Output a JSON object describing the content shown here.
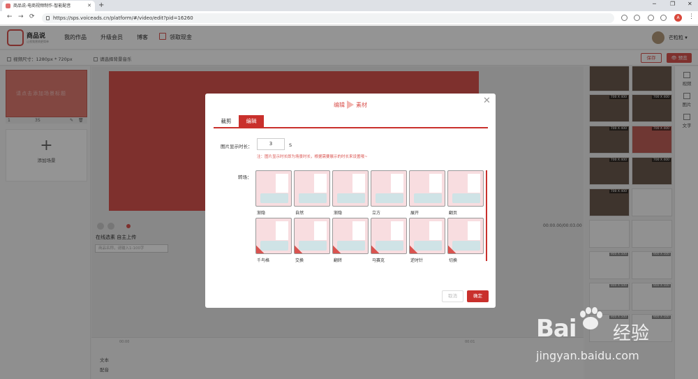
{
  "browser": {
    "tab_title": "商品说-电商视频制作-智能配音",
    "url": "https://sps.voiceads.cn/platform/#/video/edit?pid=16260",
    "profile_initial": "A"
  },
  "app": {
    "logo_text": "商品说",
    "logo_sub": "让视频营销更简单",
    "nav": [
      "我的作品",
      "升级会员",
      "博客",
      "领取现金"
    ],
    "username": "芒粒粒 ▾"
  },
  "toolbar": {
    "video_size": "视频尺寸：1280px * 720px",
    "bg_music": "请选择背景音乐",
    "save": "保存",
    "preview": "👁 预览"
  },
  "scenes": {
    "card_text": "请点击添加场景标题",
    "card_index": "1",
    "card_duration": "3S",
    "add_label": "添加场景"
  },
  "stage": {
    "timecode": "00:00.00/00:03.00",
    "subtabs": "在线选素    自主上传",
    "search_placeholder": "商品名称，请输入1-100字",
    "lower_labels": [
      "文本",
      "配音"
    ],
    "ticks": [
      "00:00",
      "00:01"
    ]
  },
  "media": {
    "badges": [
      "700 X 400",
      "700 X 400",
      "700 X 400",
      "700 X 400",
      "700 X 400",
      "700 X 400",
      "700 X 400",
      "900 X 500",
      "900 X 500",
      "900 X 500",
      "900 X 500",
      "900 X 500",
      "900 X 500"
    ]
  },
  "rail": {
    "items": [
      "视频",
      "图片",
      "文字"
    ]
  },
  "modal": {
    "title_left": "编辑",
    "title_right": "素材",
    "tabs": [
      "裁剪",
      "编辑"
    ],
    "duration_label": "图片显示时长：",
    "duration_value": "3",
    "duration_unit": "S",
    "note": "注：图片显示时长即为场景时长，根据需要展示的时长来设置哦~",
    "transition_label": "转场：",
    "transitions": [
      "渐隐",
      "自然",
      "渐隐",
      "立方",
      "展开",
      "翻页",
      "千鸟格",
      "交换",
      "翻转",
      "马赛克",
      "逆时针",
      "切换"
    ],
    "cancel": "取消",
    "confirm": "确定"
  },
  "watermark": {
    "brand": "Bai",
    "brand_tail": "经验",
    "url": "jingyan.baidu.com"
  }
}
